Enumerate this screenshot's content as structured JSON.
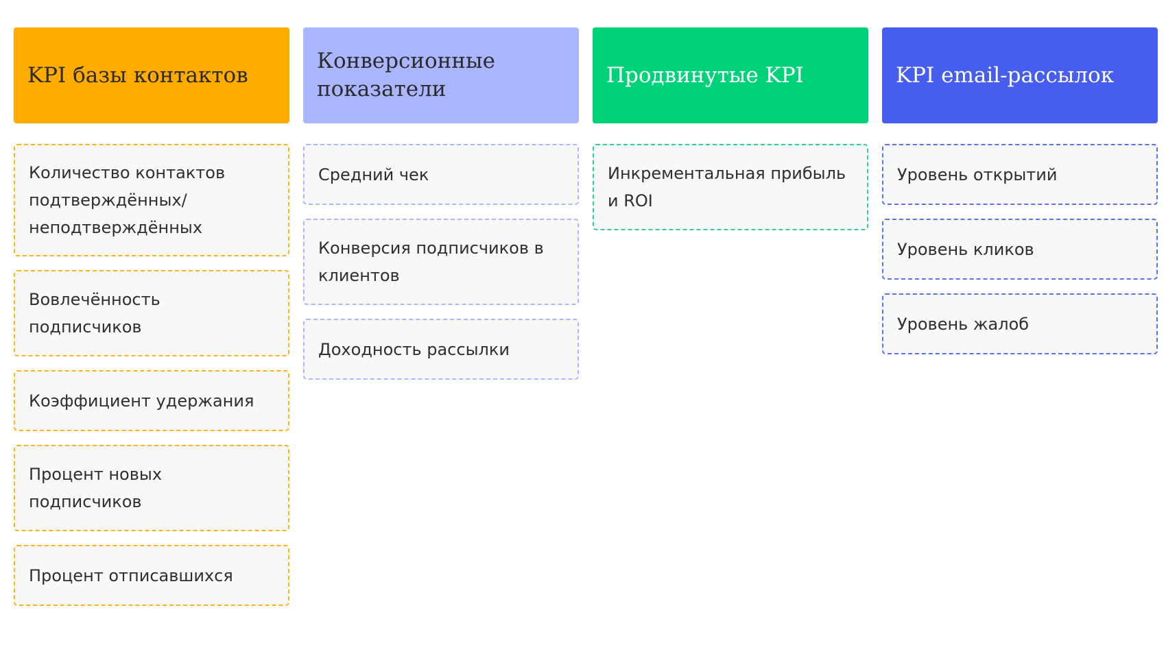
{
  "columns": [
    {
      "title": "KPI базы контактов",
      "color": "#ffab00",
      "items": [
        "Количество контактов подтверждённых/ неподтверждённых",
        "Вовлечённость подписчиков",
        "Коэффициент удержания",
        "Процент новых подписчиков",
        "Процент отписавшихся"
      ]
    },
    {
      "title": "Конверсионные показатели",
      "color": "#aab6ff",
      "items": [
        "Средний чек",
        "Конверсия подписчиков в клиентов",
        "Доходность рассылки"
      ]
    },
    {
      "title": "Продвинутые KPI",
      "color": "#00d27a",
      "items": [
        "Инкрементальная прибыль и ROI"
      ]
    },
    {
      "title": "KPI email-рассылок",
      "color": "#475ded",
      "items": [
        "Уровень открытий",
        "Уровень кликов",
        "Уровень жалоб"
      ]
    }
  ]
}
